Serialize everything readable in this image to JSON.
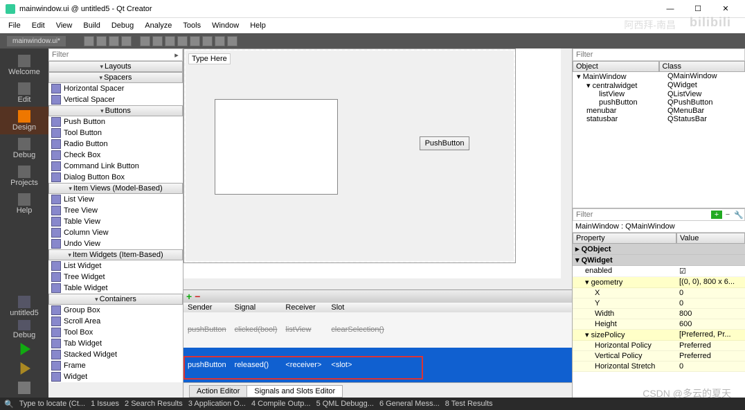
{
  "window": {
    "title": "mainwindow.ui @ untitled5 - Qt Creator"
  },
  "menubar": [
    "File",
    "Edit",
    "View",
    "Build",
    "Debug",
    "Analyze",
    "Tools",
    "Window",
    "Help"
  ],
  "toolbar_tab": "mainwindow.ui*",
  "leftdock": [
    "Welcome",
    "Edit",
    "Design",
    "Debug",
    "Projects",
    "Help"
  ],
  "leftdock_bottom_project": "untitled5",
  "leftdock_bottom_config": "Debug",
  "widgetbox": {
    "filter": "Filter",
    "categories": [
      {
        "name": "Layouts",
        "items": []
      },
      {
        "name": "Spacers",
        "items": [
          "Horizontal Spacer",
          "Vertical Spacer"
        ]
      },
      {
        "name": "Buttons",
        "items": [
          "Push Button",
          "Tool Button",
          "Radio Button",
          "Check Box",
          "Command Link Button",
          "Dialog Button Box"
        ]
      },
      {
        "name": "Item Views (Model-Based)",
        "items": [
          "List View",
          "Tree View",
          "Table View",
          "Column View",
          "Undo View"
        ]
      },
      {
        "name": "Item Widgets (Item-Based)",
        "items": [
          "List Widget",
          "Tree Widget",
          "Table Widget"
        ]
      },
      {
        "name": "Containers",
        "items": [
          "Group Box",
          "Scroll Area",
          "Tool Box",
          "Tab Widget",
          "Stacked Widget",
          "Frame",
          "Widget"
        ]
      }
    ]
  },
  "canvas": {
    "type_here": "Type Here",
    "push_button": "PushButton"
  },
  "signals": {
    "headers": [
      "Sender",
      "Signal",
      "Receiver",
      "Slot"
    ],
    "row_strike": {
      "sender": "pushButton",
      "signal": "clicked(bool)",
      "receiver": "listView",
      "slot": "clearSelection()"
    },
    "row_sel": {
      "sender": "pushButton",
      "signal": "released()",
      "receiver": "<receiver>",
      "slot": "<slot>"
    }
  },
  "bottom_tabs": {
    "action": "Action Editor",
    "signals": "Signals and Slots Editor"
  },
  "objectinspector": {
    "filter": "Filter",
    "headers": {
      "object": "Object",
      "class": "Class"
    },
    "rows": [
      {
        "ind": 0,
        "obj": "MainWindow",
        "cls": "QMainWindow",
        "exp": "▾"
      },
      {
        "ind": 1,
        "obj": "centralwidget",
        "cls": "QWidget",
        "exp": "▾"
      },
      {
        "ind": 2,
        "obj": "listView",
        "cls": "QListView"
      },
      {
        "ind": 2,
        "obj": "pushButton",
        "cls": "QPushButton"
      },
      {
        "ind": 1,
        "obj": "menubar",
        "cls": "QMenuBar"
      },
      {
        "ind": 1,
        "obj": "statusbar",
        "cls": "QStatusBar"
      }
    ]
  },
  "propertyeditor": {
    "filter": "Filter",
    "title": "MainWindow : QMainWindow",
    "headers": {
      "property": "Property",
      "value": "Value"
    },
    "groups": [
      {
        "kind": "grp",
        "k": "QObject",
        "v": "",
        "exp": "▸"
      },
      {
        "kind": "grp",
        "k": "QWidget",
        "v": "",
        "exp": "▾"
      },
      {
        "kind": "row",
        "k": "enabled",
        "v": "☑",
        "sub": 1
      },
      {
        "kind": "yel",
        "k": "geometry",
        "v": "[(0, 0), 800 x 6...",
        "exp": "▾",
        "sub": 1
      },
      {
        "kind": "yel2",
        "k": "X",
        "v": "0",
        "sub": 2
      },
      {
        "kind": "yel2",
        "k": "Y",
        "v": "0",
        "sub": 2
      },
      {
        "kind": "yel2",
        "k": "Width",
        "v": "800",
        "sub": 2
      },
      {
        "kind": "yel2",
        "k": "Height",
        "v": "600",
        "sub": 2
      },
      {
        "kind": "yel",
        "k": "sizePolicy",
        "v": "[Preferred, Pr...",
        "exp": "▾",
        "sub": 1
      },
      {
        "kind": "yel2",
        "k": "Horizontal Policy",
        "v": "Preferred",
        "sub": 2
      },
      {
        "kind": "yel2",
        "k": "Vertical Policy",
        "v": "Preferred",
        "sub": 2
      },
      {
        "kind": "yel2",
        "k": "Horizontal Stretch",
        "v": "0",
        "sub": 2
      }
    ]
  },
  "statusbar": {
    "locate": "Type to locate (Ct...",
    "items": [
      "1 Issues",
      "2 Search Results",
      "3 Application O...",
      "4 Compile Outp...",
      "5 QML Debugg...",
      "6 General Mess...",
      "8 Test Results"
    ]
  },
  "watermarks": {
    "a": "阿西拜-南昌",
    "b": "bilibili",
    "c": "CSDN @多云的夏天"
  }
}
